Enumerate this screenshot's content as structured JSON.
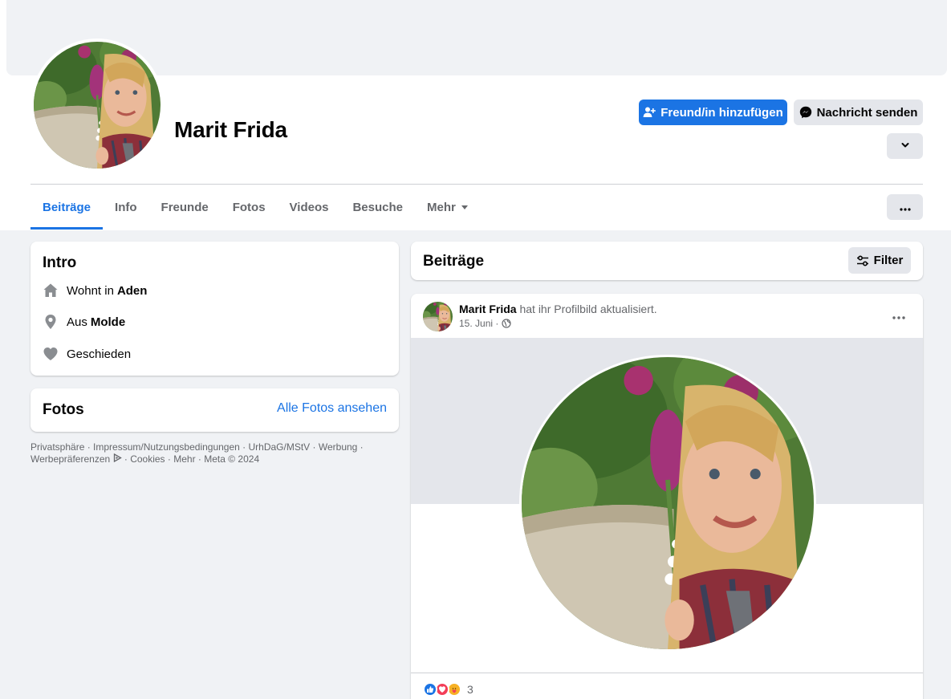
{
  "profile": {
    "name": "Marit Frida",
    "add_friend_label": "Freund/in hinzufügen",
    "message_label": "Nachricht senden"
  },
  "tabs": [
    {
      "label": "Beiträge",
      "active": true
    },
    {
      "label": "Info"
    },
    {
      "label": "Freunde"
    },
    {
      "label": "Fotos"
    },
    {
      "label": "Videos"
    },
    {
      "label": "Besuche"
    },
    {
      "label": "Mehr"
    }
  ],
  "intro": {
    "title": "Intro",
    "rows": [
      {
        "icon": "home-icon",
        "prefix": "Wohnt in",
        "value": "Aden"
      },
      {
        "icon": "location-pin-icon",
        "prefix": "Aus",
        "value": "Molde"
      },
      {
        "icon": "heart-icon",
        "prefix": "Geschieden",
        "value": ""
      }
    ]
  },
  "photos": {
    "title": "Fotos",
    "see_all_label": "Alle Fotos ansehen"
  },
  "footer": {
    "links": [
      "Privatsphäre",
      "Impressum/Nutzungsbedingungen",
      "UrhDaG/MStV",
      "Werbung",
      "Werbepräferenzen",
      "Cookies",
      "Mehr"
    ],
    "copyright": "Meta © 2024"
  },
  "posts": {
    "title": "Beiträge",
    "filter_label": "Filter"
  },
  "post": {
    "author": "Marit Frida",
    "action": "hat ihr Profilbild aktualisiert.",
    "date": "15. Juni",
    "reaction_count": "3"
  },
  "colors": {
    "accent": "#1b74e4",
    "background": "#f0f2f5",
    "button_gray": "#e4e6eb",
    "text_secondary": "#65676b"
  }
}
